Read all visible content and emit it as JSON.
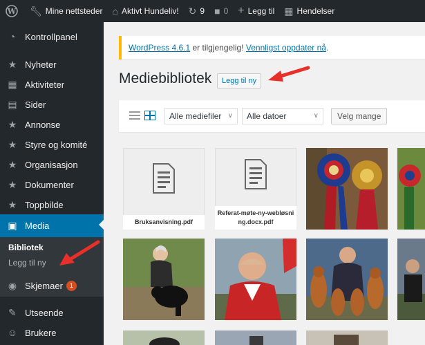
{
  "adminbar": {
    "wp_logo": "wordpress-icon",
    "my_sites": "Mine nettsteder",
    "site_name": "Aktivt Hundeliv!",
    "updates_count": "9",
    "comments_count": "0",
    "new_label": "Legg til",
    "events_label": "Hendelser"
  },
  "sidebar": {
    "items": [
      {
        "label": "Kontrollpanel",
        "icon": "dashboard-icon"
      },
      {
        "label": "Nyheter",
        "icon": "pin-icon"
      },
      {
        "label": "Aktiviteter",
        "icon": "calendar-icon"
      },
      {
        "label": "Sider",
        "icon": "pages-icon"
      },
      {
        "label": "Annonse",
        "icon": "pin-icon"
      },
      {
        "label": "Styre og komité",
        "icon": "pin-icon"
      },
      {
        "label": "Organisasjon",
        "icon": "pin-icon"
      },
      {
        "label": "Dokumenter",
        "icon": "pin-icon"
      },
      {
        "label": "Toppbilde",
        "icon": "pin-icon"
      },
      {
        "label": "Media",
        "icon": "media-icon"
      },
      {
        "label": "Skjemaer",
        "icon": "forms-icon",
        "badge": "1"
      },
      {
        "label": "Utseende",
        "icon": "appearance-icon"
      },
      {
        "label": "Brukere",
        "icon": "users-icon"
      }
    ],
    "submenu": {
      "library": "Bibliotek",
      "add_new": "Legg til ny"
    }
  },
  "notice": {
    "link1": "WordPress 4.6.1",
    "text": " er tilgjengelig! ",
    "link2": "Vennligst oppdater nå",
    "end": "."
  },
  "page": {
    "title": "Mediebibliotek",
    "add_new": "Legg til ny"
  },
  "toolbar": {
    "filter_type": "Alle mediefiler",
    "filter_date": "Alle datoer",
    "bulk_select": "Velg mange"
  },
  "media": {
    "doc1": "Bruksanvisning.pdf",
    "doc2": "Referat-møte-ny-webløsning.docx.pdf"
  },
  "colors": {
    "accent": "#0073aa",
    "adminbar": "#23282d",
    "annotation_arrow": "#e8302b"
  }
}
